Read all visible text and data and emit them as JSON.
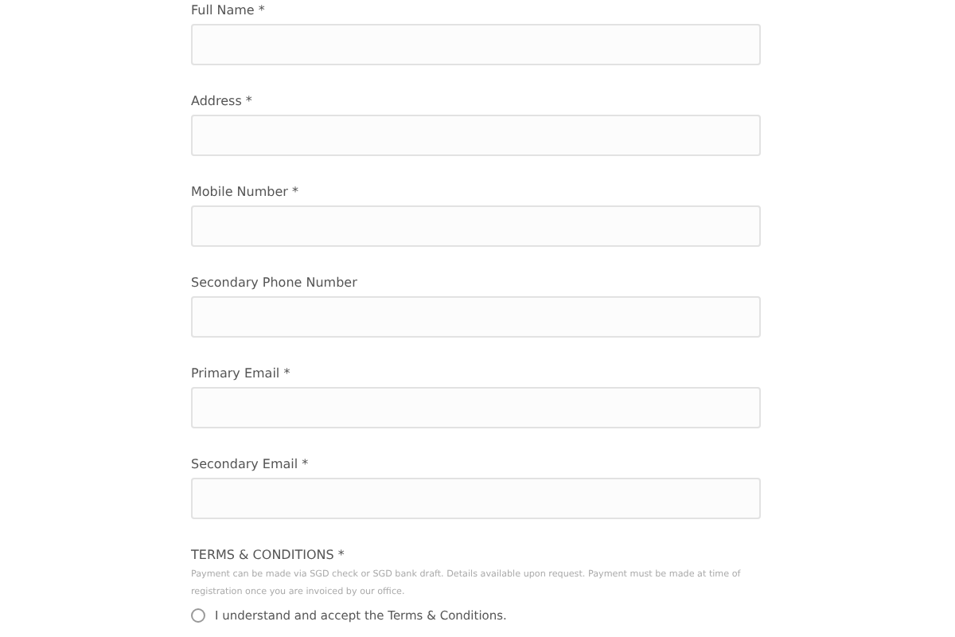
{
  "fields": [
    {
      "label": "Full Name *"
    },
    {
      "label": "Address *"
    },
    {
      "label": "Mobile Number *"
    },
    {
      "label": "Secondary Phone Number"
    },
    {
      "label": "Primary Email *"
    },
    {
      "label": "Secondary Email *"
    }
  ],
  "terms": {
    "title": "TERMS & CONDITIONS *",
    "text": "Payment can be made via SGD check or SGD bank draft. Details available upon request. Payment must be made at time of registration once you are invoiced by our office.",
    "option": {
      "label": "I understand and accept the Terms & Conditions.",
      "selected": false
    }
  }
}
